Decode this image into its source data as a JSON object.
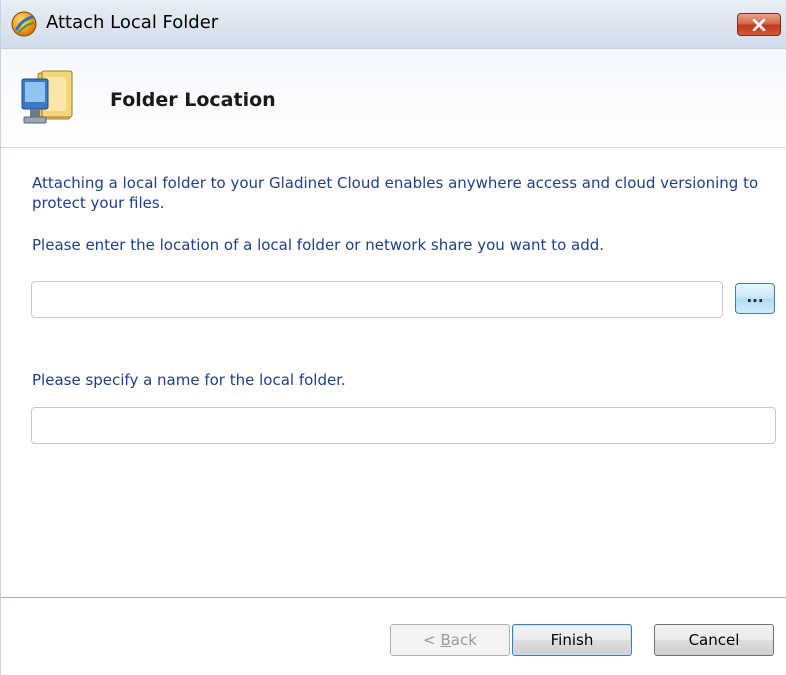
{
  "window": {
    "title": "Attach Local Folder",
    "close_symbol": "✕"
  },
  "header": {
    "title": "Folder Location",
    "icon": "folder-computer-icon"
  },
  "content": {
    "description": "Attaching a local folder to your Gladinet Cloud enables anywhere access and cloud versioning to protect your files.",
    "location_prompt": "Please enter the location of a local folder or network share you want to add.",
    "location_value": "",
    "browse_label": "...",
    "name_prompt": "Please specify a name for the local folder.",
    "name_value": ""
  },
  "buttons": {
    "back_prefix": "< ",
    "back_mnemonic": "B",
    "back_rest": "ack",
    "finish": "Finish",
    "cancel": "Cancel"
  },
  "colors": {
    "text_blue": "#1e3f8a",
    "close_red": "#c0391c",
    "title_bar": "#dbe4ef"
  }
}
